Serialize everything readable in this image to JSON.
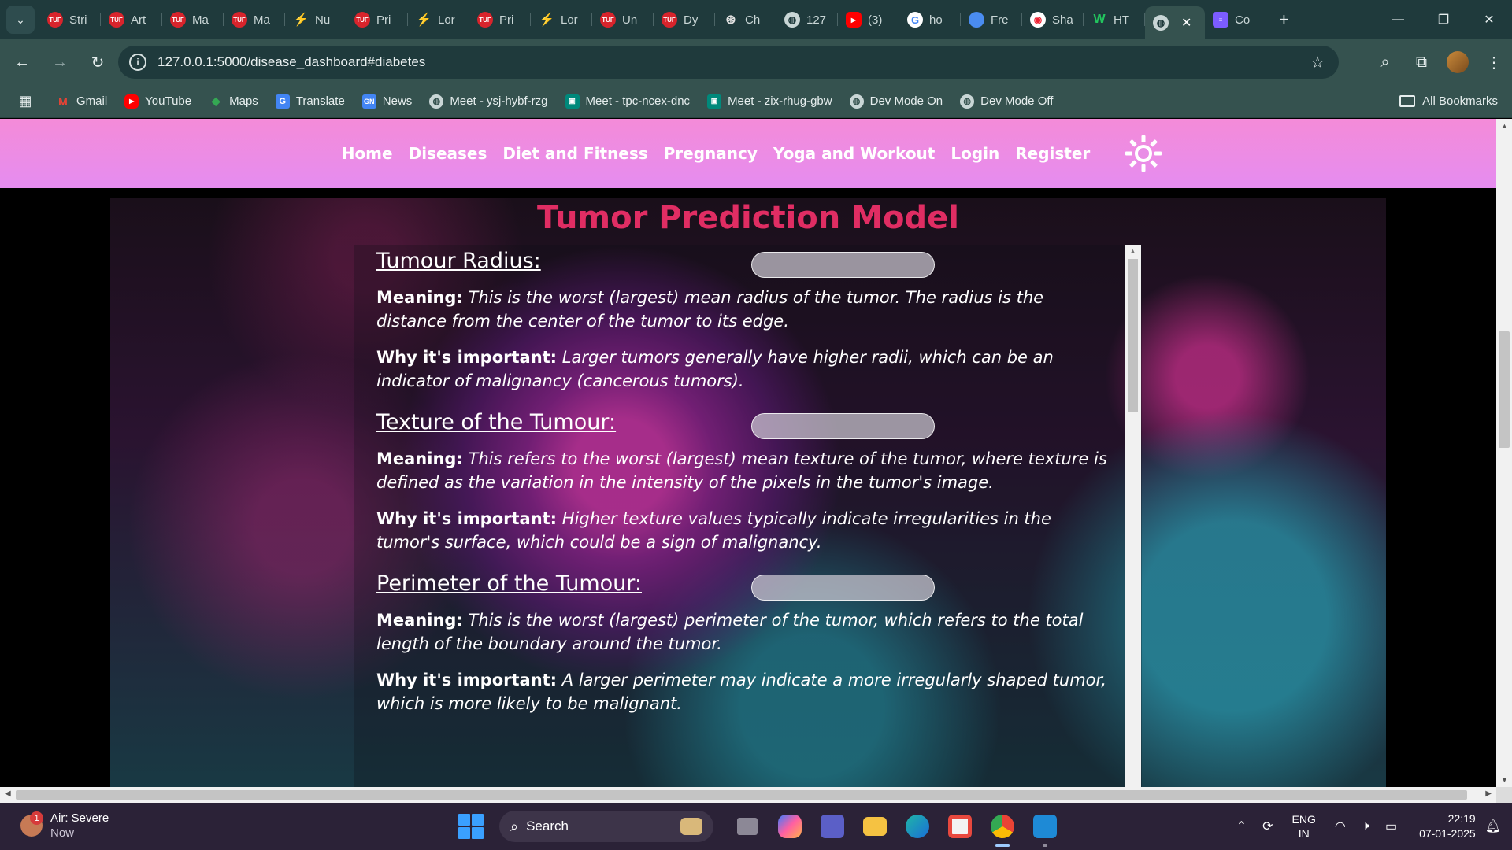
{
  "browser": {
    "tabs": [
      {
        "label": "Stri",
        "icon": "tuf"
      },
      {
        "label": "Art",
        "icon": "tuf"
      },
      {
        "label": "Ma",
        "icon": "tuf"
      },
      {
        "label": "Ma",
        "icon": "tuf"
      },
      {
        "label": "Nu",
        "icon": "lor"
      },
      {
        "label": "Pri",
        "icon": "tuf"
      },
      {
        "label": "Lor",
        "icon": "lor"
      },
      {
        "label": "Pri",
        "icon": "tuf"
      },
      {
        "label": "Lor",
        "icon": "lor"
      },
      {
        "label": "Un",
        "icon": "tuf"
      },
      {
        "label": "Dy",
        "icon": "tuf"
      },
      {
        "label": "Ch",
        "icon": "gpt"
      },
      {
        "label": "127",
        "icon": "globe"
      },
      {
        "label": "(3)",
        "icon": "yt"
      },
      {
        "label": "ho",
        "icon": "goog"
      },
      {
        "label": "Fre",
        "icon": "gem"
      },
      {
        "label": "Sha",
        "icon": "sha"
      },
      {
        "label": "HT",
        "icon": "w"
      },
      {
        "label": "",
        "icon": "globe",
        "active": true
      },
      {
        "label": "Co",
        "icon": "co"
      }
    ],
    "url": "127.0.0.1:5000/disease_dashboard#diabetes",
    "bookmarks": [
      {
        "label": "Gmail",
        "icon": "gm"
      },
      {
        "label": "YouTube",
        "icon": "yt"
      },
      {
        "label": "Maps",
        "icon": "mp"
      },
      {
        "label": "Translate",
        "icon": "tr"
      },
      {
        "label": "News",
        "icon": "nw"
      },
      {
        "label": "Meet - ysj-hybf-rzg",
        "icon": "gl"
      },
      {
        "label": "Meet - tpc-ncex-dnc",
        "icon": "mt"
      },
      {
        "label": "Meet - zix-rhug-gbw",
        "icon": "mt"
      },
      {
        "label": "Dev Mode On",
        "icon": "gl"
      },
      {
        "label": "Dev Mode Off",
        "icon": "gl"
      }
    ],
    "all_bookmarks": "All Bookmarks"
  },
  "site": {
    "nav": [
      "Home",
      "Diseases",
      "Diet and Fitness",
      "Pregnancy",
      "Yoga and Workout",
      "Login",
      "Register"
    ],
    "title": "Tumor Prediction Model",
    "fields": [
      {
        "label": "Tumour Radius:",
        "meaning_label": "Meaning:",
        "meaning": "This is the worst (largest) mean radius of the tumor. The radius is the distance from the center of the tumor to its edge.",
        "why_label": "Why it's important:",
        "why": "Larger tumors generally have higher radii, which can be an indicator of malignancy (cancerous tumors)."
      },
      {
        "label": "Texture of the Tumour:",
        "meaning_label": "Meaning:",
        "meaning": "This refers to the worst (largest) mean texture of the tumor, where texture is defined as the variation in the intensity of the pixels in the tumor's image.",
        "why_label": "Why it's important:",
        "why": "Higher texture values typically indicate irregularities in the tumor's surface, which could be a sign of malignancy."
      },
      {
        "label": "Perimeter of the Tumour:",
        "meaning_label": "Meaning:",
        "meaning": "This is the worst (largest) perimeter of the tumor, which refers to the total length of the boundary around the tumor.",
        "why_label": "Why it's important:",
        "why": "A larger perimeter may indicate a more irregularly shaped tumor, which is more likely to be malignant."
      }
    ]
  },
  "taskbar": {
    "weather_title": "Air: Severe",
    "weather_sub": "Now",
    "weather_badge": "1",
    "search": "Search",
    "lang_1": "ENG",
    "lang_2": "IN",
    "time": "22:19",
    "date": "07-01-2025"
  },
  "colors": {
    "title": "#e02d63",
    "nav_gradient_start": "#f48bd8",
    "nav_gradient_end": "#e58cf0",
    "browser_frame": "#1f3a3c",
    "taskbar": "#2b2237"
  }
}
